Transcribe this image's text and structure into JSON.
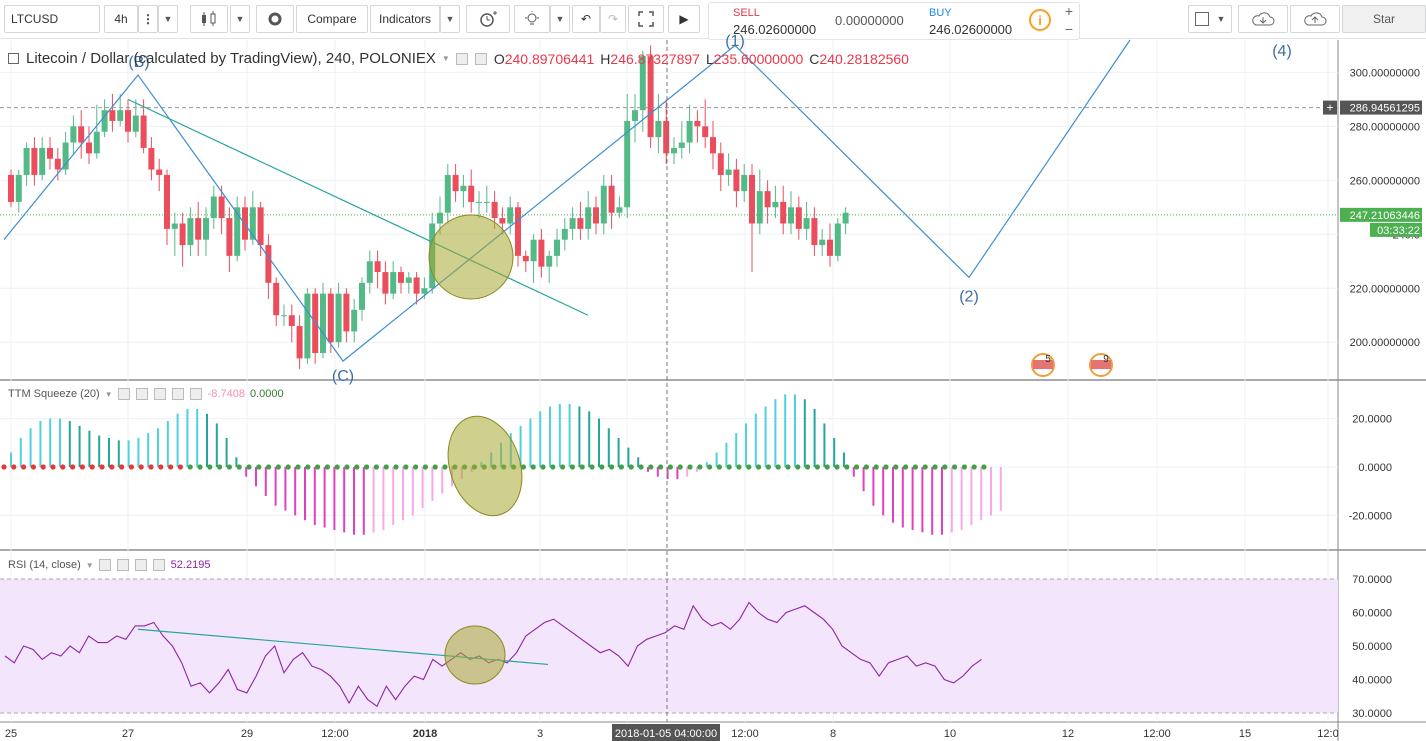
{
  "toolbar": {
    "symbol": "LTCUSD",
    "interval": "4h",
    "more_label": "⋮",
    "dropdown_arrow": "▼",
    "compare_label": "Compare",
    "indicators_label": "Indicators",
    "undo": "↶",
    "redo": "↷",
    "play": "▶",
    "star_label": "Star"
  },
  "trade": {
    "sell_label": "SELL",
    "sell_price": "246.02600000",
    "spread": "0.00000000",
    "buy_label": "BUY",
    "buy_price": "246.02600000",
    "info": "i",
    "plus": "+",
    "minus": "−"
  },
  "legend": {
    "title": "Litecoin / Dollar (calculated by TradingView), 240, POLONIEX",
    "o_label": "O",
    "o": "240.89706441",
    "h_label": "H",
    "h": "246.87327897",
    "l_label": "L",
    "l": "235.60000000",
    "c_label": "C",
    "c": "240.28182560"
  },
  "ttm": {
    "label": "TTM Squeeze (20)",
    "v1": "-8.7408",
    "v2": "0.0000"
  },
  "rsi": {
    "label": "RSI (14, close)",
    "v": "52.2195"
  },
  "price_axis": {
    "ticks": [
      "300.00000000",
      "280.00000000",
      "260.00000000",
      "240.0",
      "220.00000000",
      "200.00000000"
    ],
    "crosshair_label": "286.94561295",
    "last_price_label": "247.21063446",
    "countdown_label": "03:33:22"
  },
  "ttm_axis": {
    "ticks": [
      "20.0000",
      "0.0000",
      "-20.0000"
    ]
  },
  "rsi_axis": {
    "ticks": [
      "70.0000",
      "60.0000",
      "50.0000",
      "40.0000",
      "30.0000"
    ]
  },
  "time_axis": {
    "ticks": [
      "25",
      "27",
      "29",
      "12:00",
      "2018",
      "3",
      "8",
      "10",
      "12",
      "12:00",
      "15",
      "12:0",
      "12:00"
    ],
    "crosshair_label": "2018-01-05 04:00:00"
  },
  "wave_labels": {
    "b": "(B)",
    "c": "(C)",
    "one": "(1)",
    "two": "(2)",
    "four": "(4)"
  },
  "event_flags": {
    "first_count": "5",
    "second_count": "9"
  },
  "colors": {
    "up": "#53b987",
    "down": "#eb4d5c",
    "wave_line": "#3e8ed0",
    "trend_line": "#26a69a",
    "ellipse_fill": "#a8a832",
    "rsi_line": "#8e24aa",
    "rsi_band": "#f3e5fc",
    "ttm_up_strong": "#4dd0e1",
    "ttm_up_weak": "#26a69a",
    "ttm_down_strong": "#e040c0",
    "ttm_down_weak": "#f8a8e8"
  },
  "chart_data": {
    "type": "candlestick",
    "title": "Litecoin / Dollar (calculated by TradingView), 240, POLONIEX",
    "ylim": [
      186,
      312
    ],
    "candles": [
      [
        262,
        252,
        264,
        250
      ],
      [
        252,
        262,
        264,
        248
      ],
      [
        262,
        272,
        274,
        258
      ],
      [
        272,
        262,
        276,
        258
      ],
      [
        262,
        272,
        276,
        260
      ],
      [
        272,
        268,
        276,
        264
      ],
      [
        268,
        264,
        272,
        260
      ],
      [
        264,
        274,
        278,
        262
      ],
      [
        274,
        280,
        284,
        270
      ],
      [
        280,
        274,
        286,
        268
      ],
      [
        274,
        270,
        280,
        266
      ],
      [
        270,
        278,
        288,
        268
      ],
      [
        278,
        286,
        290,
        276
      ],
      [
        286,
        282,
        292,
        278
      ],
      [
        282,
        286,
        292,
        280
      ],
      [
        286,
        278,
        290,
        274
      ],
      [
        278,
        284,
        290,
        276
      ],
      [
        284,
        272,
        290,
        270
      ],
      [
        272,
        264,
        276,
        260
      ],
      [
        264,
        262,
        268,
        256
      ],
      [
        262,
        242,
        264,
        236
      ],
      [
        242,
        244,
        248,
        232
      ],
      [
        244,
        236,
        248,
        228
      ],
      [
        236,
        246,
        250,
        232
      ],
      [
        246,
        238,
        252,
        232
      ],
      [
        238,
        246,
        250,
        232
      ],
      [
        246,
        254,
        258,
        242
      ],
      [
        254,
        246,
        258,
        240
      ],
      [
        246,
        232,
        250,
        226
      ],
      [
        232,
        250,
        254,
        230
      ],
      [
        250,
        238,
        254,
        234
      ],
      [
        238,
        250,
        256,
        236
      ],
      [
        250,
        236,
        252,
        232
      ],
      [
        236,
        222,
        240,
        216
      ],
      [
        222,
        210,
        224,
        206
      ],
      [
        210,
        210,
        214,
        206
      ],
      [
        210,
        206,
        214,
        200
      ],
      [
        206,
        194,
        210,
        190
      ],
      [
        194,
        218,
        220,
        192
      ],
      [
        218,
        196,
        220,
        192
      ],
      [
        196,
        218,
        222,
        194
      ],
      [
        218,
        200,
        220,
        196
      ],
      [
        200,
        218,
        222,
        198
      ],
      [
        218,
        204,
        220,
        200
      ],
      [
        204,
        212,
        216,
        200
      ],
      [
        212,
        222,
        224,
        208
      ],
      [
        222,
        230,
        234,
        218
      ],
      [
        230,
        226,
        234,
        220
      ],
      [
        226,
        218,
        230,
        214
      ],
      [
        218,
        226,
        230,
        216
      ],
      [
        226,
        222,
        228,
        218
      ],
      [
        222,
        224,
        226,
        218
      ],
      [
        224,
        218,
        226,
        214
      ],
      [
        218,
        220,
        224,
        216
      ],
      [
        220,
        244,
        248,
        218
      ],
      [
        244,
        248,
        254,
        240
      ],
      [
        248,
        262,
        266,
        244
      ],
      [
        262,
        256,
        266,
        252
      ],
      [
        256,
        258,
        262,
        250
      ],
      [
        258,
        252,
        264,
        248
      ],
      [
        252,
        252,
        256,
        246
      ],
      [
        252,
        252,
        258,
        248
      ],
      [
        252,
        246,
        256,
        242
      ],
      [
        246,
        244,
        250,
        240
      ],
      [
        244,
        250,
        254,
        240
      ],
      [
        250,
        232,
        252,
        228
      ],
      [
        232,
        230,
        234,
        226
      ],
      [
        230,
        238,
        240,
        222
      ],
      [
        238,
        228,
        242,
        224
      ],
      [
        228,
        232,
        234,
        222
      ],
      [
        232,
        238,
        242,
        228
      ],
      [
        238,
        242,
        246,
        234
      ],
      [
        242,
        246,
        250,
        238
      ],
      [
        246,
        242,
        252,
        238
      ],
      [
        242,
        250,
        256,
        238
      ],
      [
        250,
        244,
        254,
        240
      ],
      [
        244,
        258,
        262,
        240
      ],
      [
        258,
        248,
        262,
        242
      ],
      [
        248,
        250,
        254,
        246
      ],
      [
        250,
        282,
        292,
        246
      ],
      [
        282,
        286,
        292,
        274
      ],
      [
        286,
        306,
        308,
        278
      ],
      [
        306,
        276,
        310,
        272
      ],
      [
        276,
        282,
        292,
        270
      ],
      [
        282,
        270,
        290,
        266
      ],
      [
        270,
        272,
        276,
        266
      ],
      [
        272,
        274,
        282,
        268
      ],
      [
        274,
        282,
        288,
        270
      ],
      [
        282,
        280,
        286,
        274
      ],
      [
        280,
        276,
        290,
        272
      ],
      [
        276,
        270,
        282,
        264
      ],
      [
        270,
        262,
        274,
        256
      ],
      [
        262,
        264,
        270,
        258
      ],
      [
        264,
        256,
        268,
        250
      ],
      [
        256,
        262,
        266,
        252
      ],
      [
        262,
        244,
        266,
        226
      ],
      [
        244,
        256,
        264,
        240
      ],
      [
        256,
        250,
        260,
        244
      ],
      [
        250,
        252,
        258,
        246
      ],
      [
        252,
        244,
        258,
        240
      ],
      [
        244,
        250,
        256,
        240
      ],
      [
        250,
        242,
        254,
        238
      ],
      [
        242,
        246,
        252,
        238
      ],
      [
        246,
        236,
        250,
        232
      ],
      [
        236,
        238,
        242,
        232
      ],
      [
        238,
        232,
        244,
        228
      ],
      [
        232,
        244,
        246,
        230
      ],
      [
        244,
        248,
        250,
        240
      ]
    ],
    "wave_points": [
      [
        "start",
        238
      ],
      [
        "(B)",
        299
      ],
      [
        "(C)",
        193
      ],
      [
        "(1)",
        310
      ],
      [
        "(2)",
        224
      ],
      [
        "(4)",
        312
      ]
    ],
    "ttm_squeeze": {
      "ylim": [
        -30,
        30
      ],
      "momentum": [
        6,
        12,
        16,
        19,
        20,
        20,
        19,
        17,
        15,
        13,
        12,
        11,
        11,
        12,
        14,
        16,
        19,
        22,
        24,
        24,
        22,
        18,
        12,
        4,
        -4,
        -8,
        -12,
        -16,
        -18,
        -20,
        -22,
        -24,
        -25,
        -26,
        -27,
        -28,
        -28,
        -27,
        -26,
        -24,
        -22,
        -20,
        -17,
        -14,
        -11,
        -8,
        -5,
        -2,
        2,
        6,
        10,
        14,
        17,
        20,
        23,
        25,
        26,
        26,
        25,
        23,
        20,
        16,
        12,
        8,
        4,
        -2,
        -4,
        -5,
        -5,
        -4,
        -2,
        2,
        6,
        10,
        14,
        18,
        22,
        25,
        28,
        30,
        30,
        28,
        24,
        18,
        12,
        6,
        -4,
        -10,
        -16,
        -20,
        -23,
        -25,
        -26,
        -27,
        -28,
        -28,
        -27,
        -26,
        -24,
        -22,
        -20,
        -18
      ]
    },
    "rsi": {
      "ylim": [
        30,
        70
      ],
      "values": [
        47,
        45,
        50,
        49,
        46,
        48,
        47,
        50,
        48,
        53,
        51,
        51,
        53,
        52,
        56,
        56,
        57,
        53,
        50,
        45,
        38,
        39,
        36,
        39,
        43,
        37,
        36,
        41,
        47,
        50,
        42,
        46,
        48,
        44,
        43,
        41,
        38,
        33,
        38,
        34,
        32,
        38,
        34,
        38,
        41,
        40,
        46,
        44,
        46,
        48,
        46,
        47,
        45,
        46,
        45,
        48,
        53,
        55,
        57,
        58,
        56,
        54,
        52,
        50,
        48,
        49,
        47,
        44,
        50,
        52,
        53,
        54,
        56,
        55,
        62,
        58,
        56,
        57,
        55,
        58,
        63,
        60,
        58,
        57,
        60,
        61,
        62,
        60,
        58,
        55,
        50,
        48,
        46,
        45,
        41,
        45,
        46,
        47,
        44,
        45,
        44,
        40,
        39,
        41,
        44,
        46
      ]
    }
  }
}
